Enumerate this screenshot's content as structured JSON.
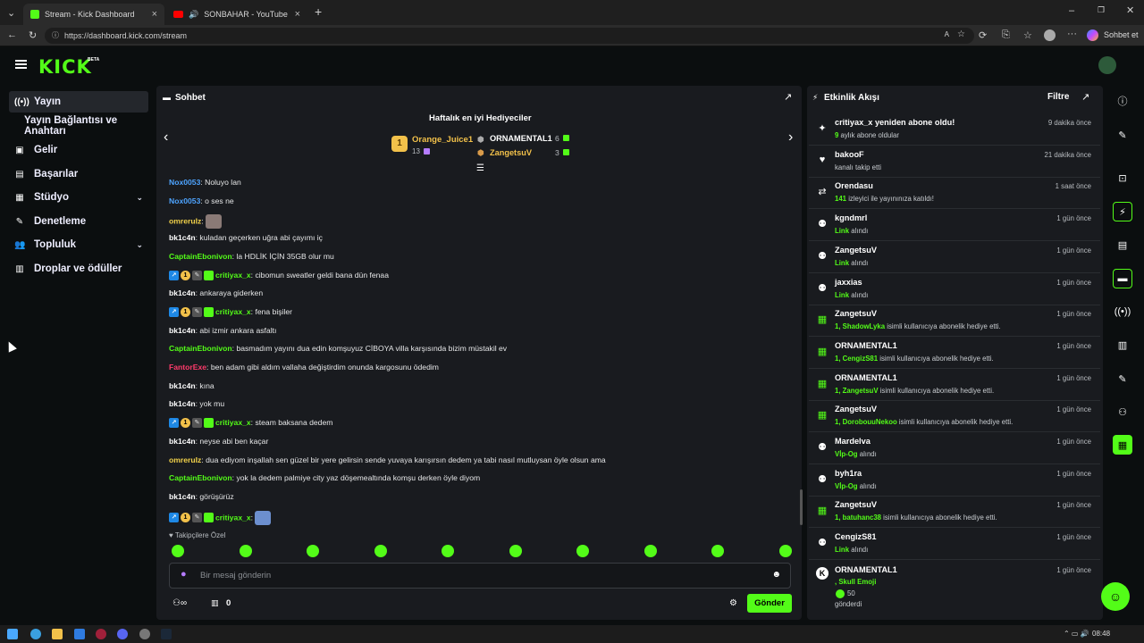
{
  "browser": {
    "tabs": [
      {
        "label": "Stream - Kick Dashboard",
        "active": true
      },
      {
        "label": "SONBAHAR - YouTube",
        "active": false
      }
    ],
    "url": "https://dashboard.kick.com/stream",
    "profile_label": "Sohbet et"
  },
  "brand": {
    "logo": "KICK",
    "badge": "BETA",
    "accent": "#53fc18"
  },
  "sidebar": {
    "items": [
      {
        "label": "Yayın",
        "icon": "broadcast-icon",
        "active": true
      },
      {
        "label": "Yayın Bağlantısı ve Anahtarı",
        "icon": "",
        "active": false
      },
      {
        "label": "Gelir",
        "icon": "dollar-icon",
        "active": false
      },
      {
        "label": "Başarılar",
        "icon": "trophy-icon",
        "active": false
      },
      {
        "label": "Stüdyo",
        "icon": "studio-icon",
        "active": false,
        "chevron": true
      },
      {
        "label": "Denetleme",
        "icon": "wrench-icon",
        "active": false
      },
      {
        "label": "Topluluk",
        "icon": "people-icon",
        "active": false,
        "chevron": true
      },
      {
        "label": "Droplar ve ödüller",
        "icon": "gift-icon",
        "active": false
      }
    ]
  },
  "chat": {
    "title": "Sohbet",
    "gifters_title": "Haftalık en iyi Hediyeciler",
    "gifters": [
      {
        "rank": "1",
        "name": "Orange_Juice1",
        "count": "13"
      },
      {
        "name": "ORNAMENTAL1",
        "count": "6"
      },
      {
        "name": "ZangetsuV",
        "count": "3"
      }
    ],
    "messages": [
      {
        "user": "Nox0053",
        "color": "blue",
        "text": "Noluyo lan"
      },
      {
        "user": "Nox0053",
        "color": "blue",
        "text": "o ses ne"
      },
      {
        "user": "omreruIz",
        "color": "yel",
        "text": "",
        "emote": true
      },
      {
        "user": "bk1c4n",
        "color": "wht",
        "text": "kuladan geçerken uğra abi çayımı iç"
      },
      {
        "user": "CaptainEbonivon",
        "color": "grn",
        "text": "la HDLİK İÇİN 35GB olur mu"
      },
      {
        "user": "critiyax_x",
        "color": "grn",
        "text": "cibomun sweatler geldi bana dün fenaa",
        "badges": true
      },
      {
        "user": "bk1c4n",
        "color": "wht",
        "text": "ankaraya giderken"
      },
      {
        "user": "critiyax_x",
        "color": "grn",
        "text": "fena bişiler",
        "badges": true
      },
      {
        "user": "bk1c4n",
        "color": "wht",
        "text": "abi izmir ankara asfaltı"
      },
      {
        "user": "CaptainEbonivon",
        "color": "grn",
        "text": "basmadım yayını dua edin komşuyuz CİBOYA villa karşısında bizim müstakil ev"
      },
      {
        "user": "FantorExe",
        "color": "red",
        "text": "ben adam gibi aldım vallaha değiştirdim onunda kargosunu ödedim"
      },
      {
        "user": "bk1c4n",
        "color": "wht",
        "text": "kına"
      },
      {
        "user": "bk1c4n",
        "color": "wht",
        "text": "yok mu"
      },
      {
        "user": "critiyax_x",
        "color": "grn",
        "text": "steam baksana dedem",
        "badges": true
      },
      {
        "user": "bk1c4n",
        "color": "wht",
        "text": "neyse abi ben kaçar"
      },
      {
        "user": "omreruIz",
        "color": "yel",
        "text": "dua ediyom inşallah sen güzel bir yere gelirsin sende yuvaya karışırsın dedem ya tabi nasıl mutluysan öyle olsun ama"
      },
      {
        "user": "CaptainEbonivon",
        "color": "grn",
        "text": "yok la dedem palmiye city yaz döşemealtında komşu derken öyle diyom"
      },
      {
        "user": "bk1c4n",
        "color": "wht",
        "text": "görüşürüz"
      },
      {
        "user": "critiyax_x",
        "color": "grn",
        "text": "",
        "badges": true,
        "emote": true
      }
    ],
    "emote_tab": "Takipçilere Özel",
    "input_placeholder": "Bir mesaj gönderin",
    "footer_count": "0",
    "send_label": "Gönder"
  },
  "activity": {
    "title": "Etkinlik Akışı",
    "filter_label": "Filtre",
    "items": [
      {
        "icon": "sparkle-icon",
        "name": "critiyax_x yeniden abone oldu!",
        "time": "9 dakika önce",
        "hl": "9",
        "sub": "aylık abone oldular"
      },
      {
        "icon": "heart-icon",
        "name": "bakooF",
        "time": "21 dakika önce",
        "hl": "",
        "sub": "kanalı takip etti"
      },
      {
        "icon": "raid-icon",
        "name": "Orendasu",
        "time": "1 saat önce",
        "hl": "141",
        "sub": "izleyici ile yayınınıza katıldı!"
      },
      {
        "icon": "link-icon",
        "name": "kgndmrl",
        "time": "1 gün önce",
        "hl": "Link",
        "sub": "alındı"
      },
      {
        "icon": "link-icon",
        "name": "ZangetsuV",
        "time": "1 gün önce",
        "hl": "Link",
        "sub": "alındı"
      },
      {
        "icon": "link-icon",
        "name": "jaxxias",
        "time": "1 gün önce",
        "hl": "Link",
        "sub": "alındı"
      },
      {
        "icon": "gift-icon",
        "name": "ZangetsuV",
        "time": "1 gün önce",
        "hl": "1, ShadowLyka",
        "sub": "isimli kullanıcıya abonelik hediye etti."
      },
      {
        "icon": "gift-icon",
        "name": "ORNAMENTAL1",
        "time": "1 gün önce",
        "hl": "1, CengizS81",
        "sub": "isimli kullanıcıya abonelik hediye etti."
      },
      {
        "icon": "gift-icon",
        "name": "ORNAMENTAL1",
        "time": "1 gün önce",
        "hl": "1, ZangetsuV",
        "sub": "isimli kullanıcıya abonelik hediye etti."
      },
      {
        "icon": "gift-icon",
        "name": "ZangetsuV",
        "time": "1 gün önce",
        "hl": "1, DorobouuNekoo",
        "sub": "isimli kullanıcıya abonelik hediye etti."
      },
      {
        "icon": "link-icon",
        "name": "Mardelva",
        "time": "1 gün önce",
        "hl": "Vİp-Og",
        "sub": "alındı"
      },
      {
        "icon": "link-icon",
        "name": "byh1ra",
        "time": "1 gün önce",
        "hl": "Vİp-Og",
        "sub": "alındı"
      },
      {
        "icon": "gift-icon",
        "name": "ZangetsuV",
        "time": "1 gün önce",
        "hl": "1, batuhanc38",
        "sub": "isimli kullanıcıya abonelik hediye etti."
      },
      {
        "icon": "link-icon",
        "name": "CengizS81",
        "time": "1 gün önce",
        "hl": "Link",
        "sub": "alındı"
      }
    ],
    "last": {
      "name": "ORNAMENTAL1",
      "time": "1 gün önce",
      "line1": ", Skull Emoji",
      "amount": "50",
      "line3": "gönderdi"
    }
  },
  "taskbar": {
    "time": "08:48"
  }
}
